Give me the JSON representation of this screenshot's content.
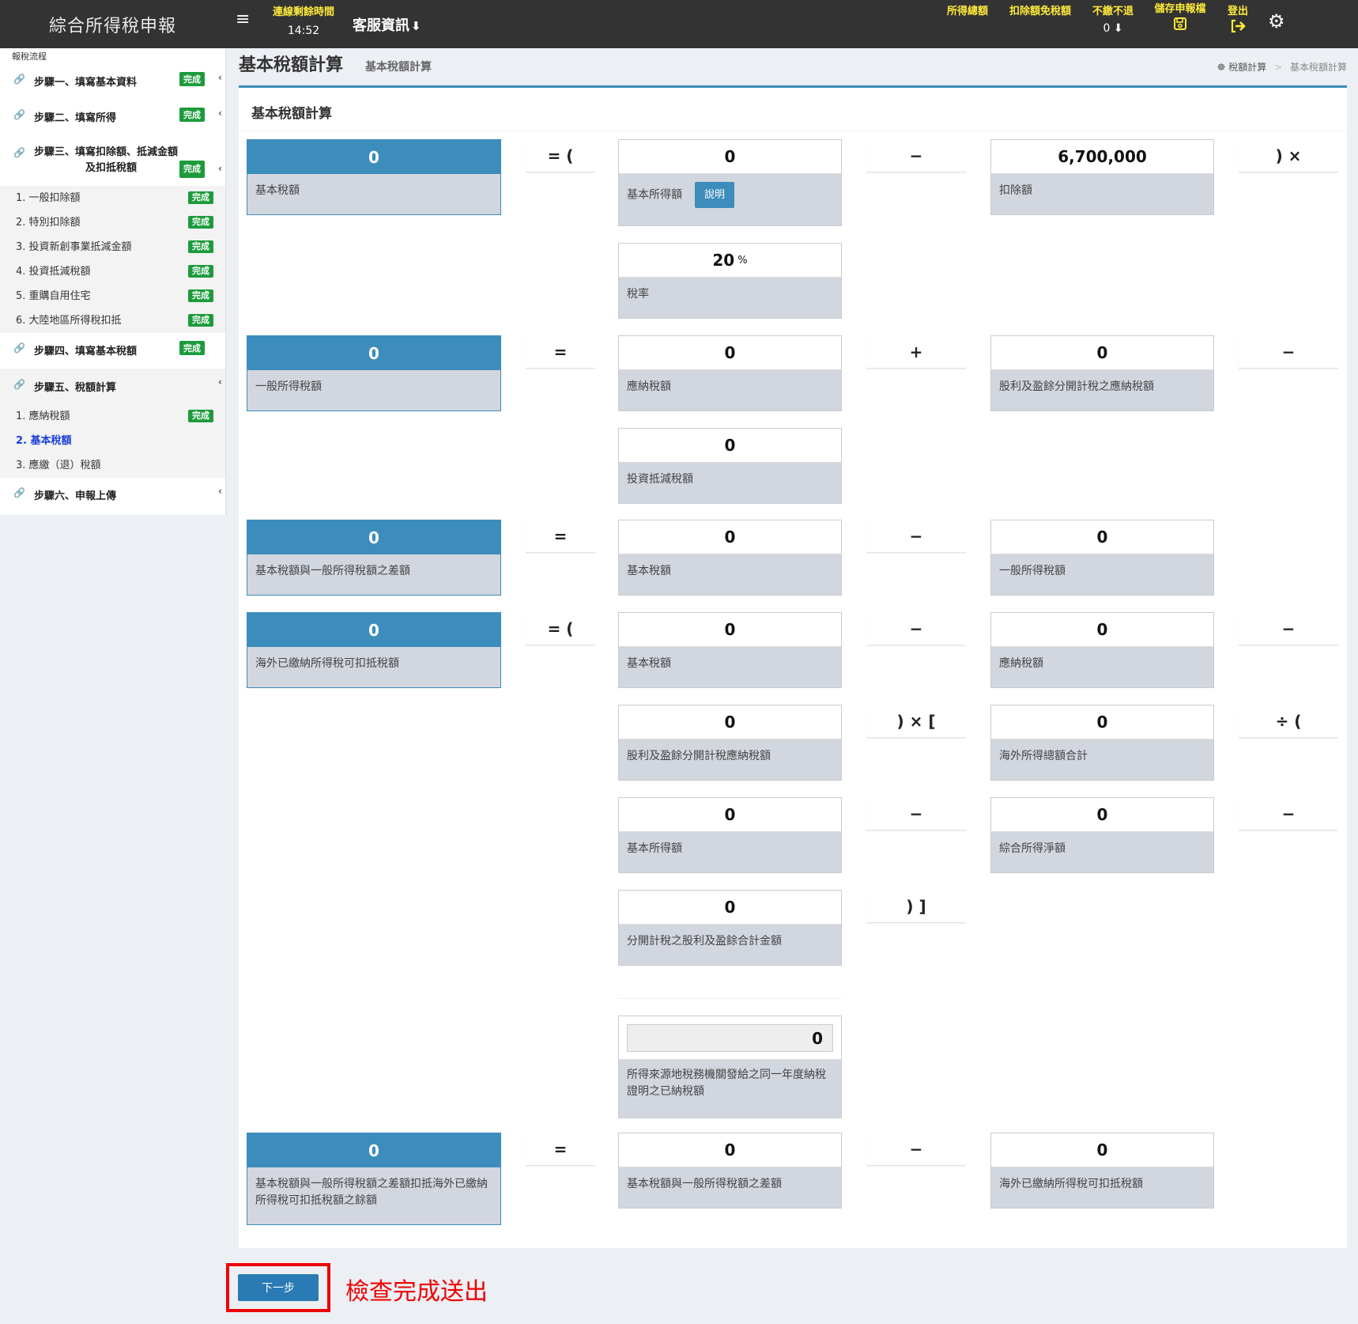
{
  "header": {
    "brand": "綜合所得稅申報",
    "menu_icon": "≡",
    "timer_label": "連線剩餘時間",
    "timer_value": "14:52",
    "service": "客服資訊",
    "nav": {
      "income": "所得總額",
      "deduct": "扣除額免稅額",
      "refund": "不繳不退",
      "refund_value": "0",
      "save": "儲存申報檔",
      "logout": "登出"
    }
  },
  "sidebar": {
    "heading": "報稅流程",
    "steps": {
      "s1": "步驟一、填寫基本資料",
      "s2": "步驟二、填寫所得",
      "s3a": "步驟三、填寫扣除額、抵減金額",
      "s3b": "及扣抵稅額",
      "s4": "步驟四、填寫基本稅額",
      "s5": "步驟五、稅額計算",
      "s6": "步驟六、申報上傳"
    },
    "badge": "完成",
    "s3_items": [
      "1. 一般扣除額",
      "2. 特別扣除額",
      "3. 投資新創事業抵減金額",
      "4. 投資抵減稅額",
      "5. 重購自用住宅",
      "6. 大陸地區所得稅扣抵"
    ],
    "s5_items": [
      "1. 應納稅額",
      "2. 基本稅額",
      "3. 應繳（退）稅額"
    ]
  },
  "page": {
    "title": "基本稅額計算",
    "subtitle": "基本稅額計算",
    "breadcrumb_home": "稅額計算",
    "breadcrumb_current": "基本稅額計算",
    "panel_title": "基本稅額計算"
  },
  "calc": {
    "r1": {
      "result": "0",
      "result_label": "基本稅額",
      "op1": "= (",
      "a": "0",
      "a_label": "基本所得額",
      "help": "說明",
      "op2": "−",
      "b": "6,700,000",
      "b_label": "扣除額",
      "op3": ") ×",
      "rate": "20",
      "rate_unit": "%",
      "rate_label": "稅率"
    },
    "r2": {
      "result": "0",
      "result_label": "一般所得稅額",
      "op1": "=",
      "a": "0",
      "a_label": "應納稅額",
      "op2": "+",
      "b": "0",
      "b_label": "股利及盈餘分開計稅之應納稅額",
      "op3": "−",
      "c": "0",
      "c_label": "投資抵減稅額"
    },
    "r3": {
      "result": "0",
      "result_label": "基本稅額與一般所得稅額之差額",
      "op1": "=",
      "a": "0",
      "a_label": "基本稅額",
      "op2": "−",
      "b": "0",
      "b_label": "一般所得稅額"
    },
    "r4": {
      "result": "0",
      "result_label": "海外已繳納所得稅可扣抵稅額",
      "op1": "= (",
      "a": "0",
      "a_label": "基本稅額",
      "op2": "−",
      "b": "0",
      "b_label": "應納稅額",
      "op3": "−",
      "c": "0",
      "c_label": "股利及盈餘分開計稅應納稅額",
      "op4": ") × [",
      "d": "0",
      "d_label": "海外所得總額合計",
      "op5": "÷ (",
      "e": "0",
      "e_label": "基本所得額",
      "op6": "−",
      "f": "0",
      "f_label": "綜合所得淨額",
      "op7": "−",
      "g": "0",
      "g_label": "分開計稅之股利及盈餘合計金額",
      "op8": ") ]",
      "h": "0",
      "h_label": "所得來源地稅務機關發給之同一年度納稅證明之已納稅額"
    },
    "r5": {
      "result": "0",
      "result_label": "基本稅額與一般所得稅額之差額扣抵海外已繳納所得稅可扣抵稅額之餘額",
      "op1": "=",
      "a": "0",
      "a_label": "基本稅額與一般所得稅額之差額",
      "op2": "−",
      "b": "0",
      "b_label": "海外已繳納所得稅可扣抵稅額"
    }
  },
  "footer": {
    "next": "下一步",
    "note": "檢查完成送出"
  }
}
